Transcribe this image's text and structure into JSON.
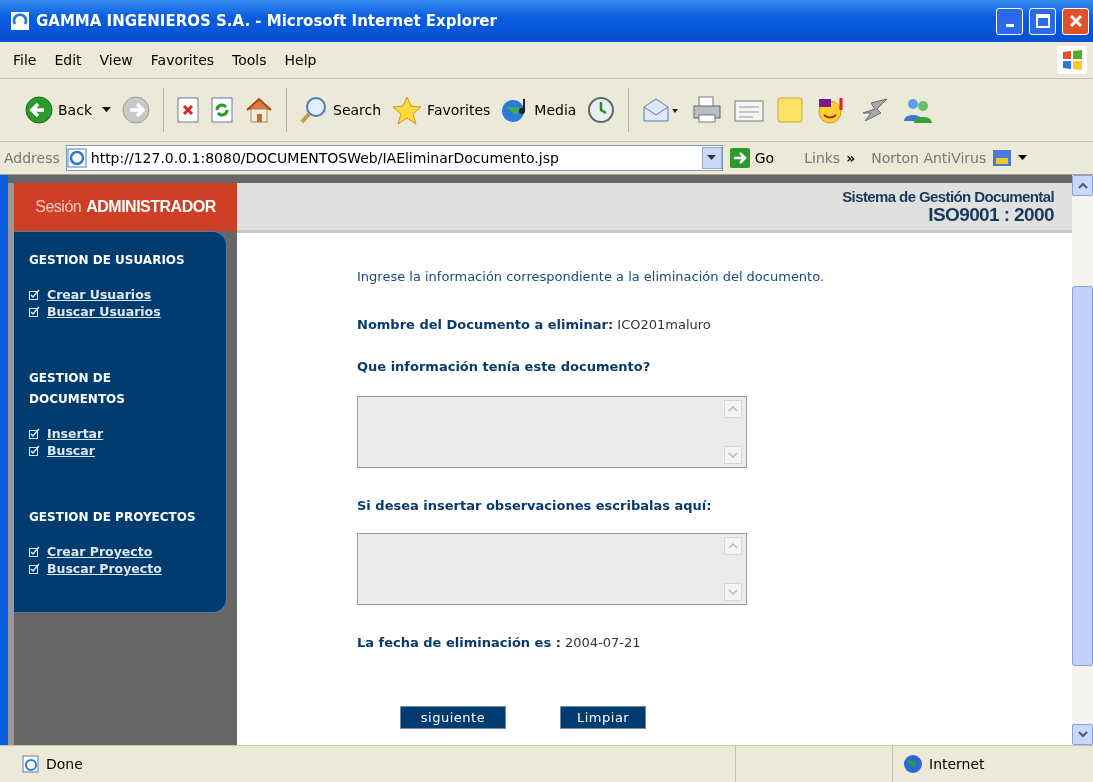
{
  "window": {
    "title": "GAMMA INGENIEROS S.A. - Microsoft Internet Explorer"
  },
  "menu": [
    "File",
    "Edit",
    "View",
    "Favorites",
    "Tools",
    "Help"
  ],
  "toolbar": [
    {
      "kind": "back",
      "label": "Back"
    },
    {
      "kind": "forward"
    },
    {
      "kind": "stop"
    },
    {
      "kind": "refresh"
    },
    {
      "kind": "home"
    },
    {
      "kind": "search",
      "label": "Search"
    },
    {
      "kind": "favorites",
      "label": "Favorites"
    },
    {
      "kind": "media",
      "label": "Media"
    },
    {
      "kind": "history"
    },
    {
      "kind": "mail"
    },
    {
      "kind": "print"
    },
    {
      "kind": "edit"
    },
    {
      "kind": "note"
    },
    {
      "kind": "messenger"
    },
    {
      "kind": "tool"
    },
    {
      "kind": "people"
    }
  ],
  "address": {
    "label": "Address",
    "url": "http://127.0.0.1:8080/DOCUMENTOSWeb/IAEliminarDocumento.jsp",
    "go": "Go",
    "links": "Links",
    "more": "»",
    "norton": "Norton AntiVirus"
  },
  "sidebar": {
    "session_label": "Sesión",
    "session_role": "ADMINISTRADOR",
    "sections": [
      {
        "title": [
          "GESTION DE USUARIOS"
        ],
        "links": [
          "Crear Usuarios",
          "Buscar Usuarios"
        ]
      },
      {
        "title": [
          "GESTION DE",
          "DOCUMENTOS"
        ],
        "links": [
          "Insertar",
          "Buscar"
        ]
      },
      {
        "title": [
          "GESTION DE PROYECTOS"
        ],
        "links": [
          "Crear Proyecto",
          "Buscar Proyecto"
        ]
      }
    ]
  },
  "header": {
    "system": "Sistema de Gestión Documental",
    "standard": "ISO9001 : 2000"
  },
  "form": {
    "intro": "Ingrese la información correspondiente a la eliminación del documento.",
    "document_label": "Nombre del Documento a eliminar:",
    "document_name": "ICO201maluro",
    "info_label": "Que información tenía este documento?",
    "observations_label": "Si desea insertar observaciones escribalas aquí:",
    "date_label": "La fecha de eliminación es :",
    "date": "2004-07-21",
    "buttons": [
      "siguiente",
      "Limpiar"
    ]
  },
  "status_bar": {
    "text": "Done",
    "zone": "Internet"
  }
}
